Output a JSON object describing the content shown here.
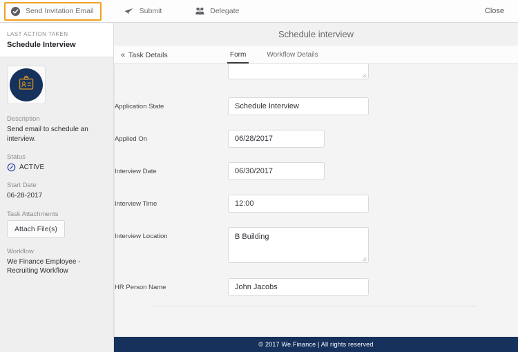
{
  "toolbar": {
    "buttons": [
      {
        "label": "Send Invitation Email",
        "icon": "check-circle-icon",
        "active": true
      },
      {
        "label": "Submit",
        "icon": "paper-plane-icon",
        "active": false
      },
      {
        "label": "Delegate",
        "icon": "people-icon",
        "active": false
      }
    ],
    "close_label": "Close",
    "active_border_color": "#f0a022"
  },
  "header": {
    "title": "Schedule interview"
  },
  "sidebar": {
    "kicker": "LAST ACTION TAKEN",
    "action_title": "Schedule Interview",
    "avatar_icon": "id-badge-icon",
    "avatar_bg": "#15315c",
    "avatar_fg": "#c08a2a",
    "description_label": "Description",
    "description_value": "Send email to schedule an interview.",
    "status_label": "Status",
    "status_value": "ACTIVE",
    "status_icon": "clock-circle-icon",
    "status_color": "#2b3ea8",
    "start_date_label": "Start Date",
    "start_date_value": "06-28-2017",
    "attachments_label": "Task Attachments",
    "attach_button_label": "Attach File(s)",
    "workflow_label": "Workflow",
    "workflow_value": "We Finance Employee - Recruiting Workflow"
  },
  "main": {
    "task_details_label": "Task Details",
    "task_details_icon": "double-chevron-left-icon",
    "tabs": [
      {
        "label": "Form",
        "active": true
      },
      {
        "label": "Workflow Details",
        "active": false
      }
    ],
    "fields": [
      {
        "label": "",
        "value": "",
        "type": "textarea",
        "partial": true
      },
      {
        "label": "Application State",
        "value": "Schedule Interview",
        "type": "text",
        "width": "wide"
      },
      {
        "label": "Applied On",
        "value": "06/28/2017",
        "type": "text",
        "width": "narrow"
      },
      {
        "label": "Interview Date",
        "value": "06/30/2017",
        "type": "text",
        "width": "narrow"
      },
      {
        "label": "Interview Time",
        "value": "12:00",
        "type": "text",
        "width": "wide"
      },
      {
        "label": "Interview Location",
        "value": "B Building",
        "type": "textarea",
        "width": "wide"
      },
      {
        "label": "HR Person Name",
        "value": "John Jacobs",
        "type": "text",
        "width": "wide"
      }
    ]
  },
  "footer": {
    "text": "© 2017 We.Finance | All rights reserved",
    "bg": "#15315c"
  }
}
